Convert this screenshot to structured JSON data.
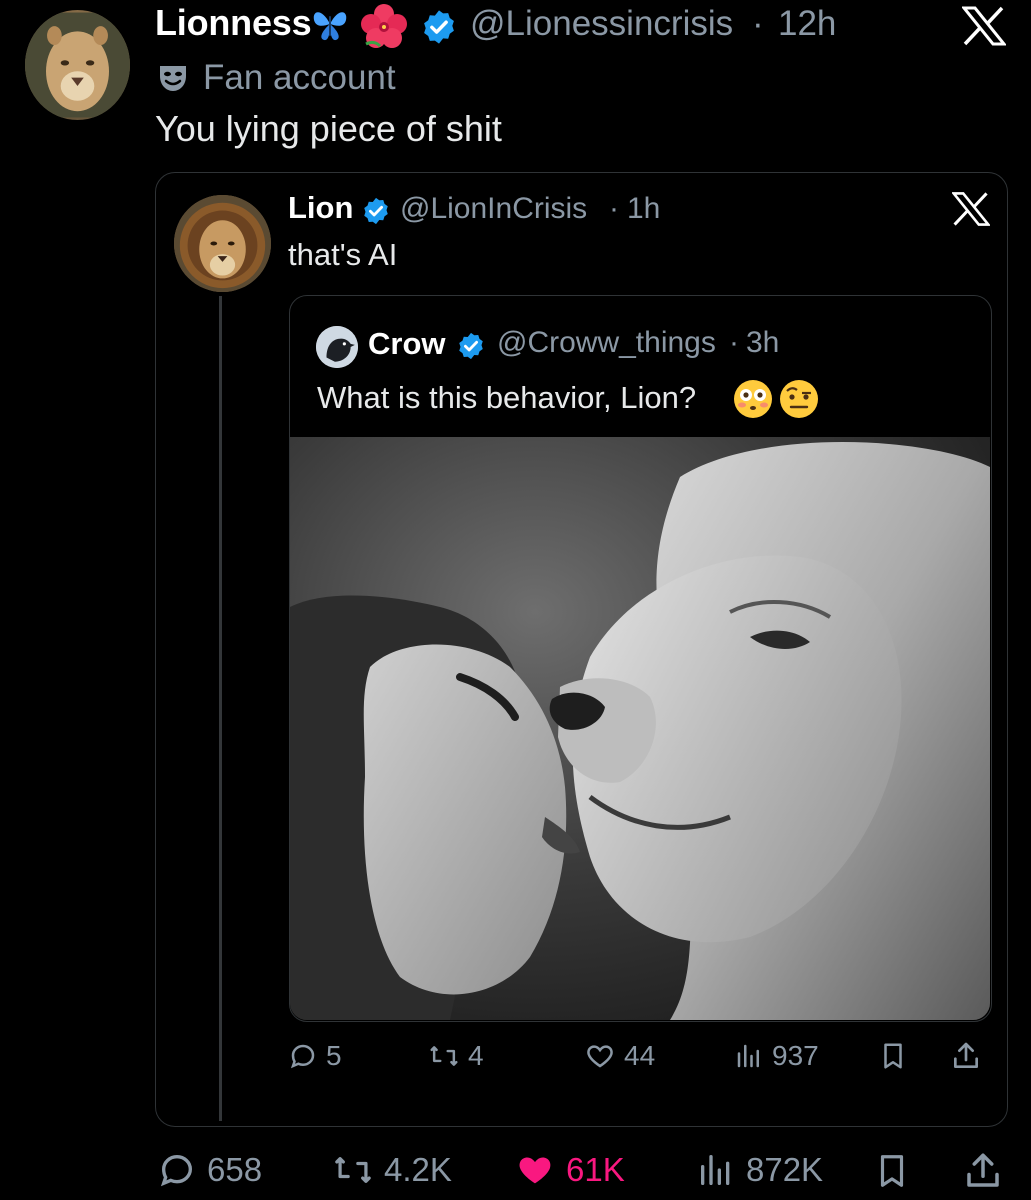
{
  "main_tweet": {
    "author_name": "Lionness",
    "handle": "@Lionessincrisis",
    "separator": "·",
    "time": "12h",
    "label_text": "Fan account",
    "text": "You lying piece of shit",
    "icons": [
      "butterfly-emoji",
      "hibiscus-emoji",
      "verified-badge-icon",
      "x-logo-icon",
      "fan-account-mask-icon"
    ],
    "actions": {
      "replies": "658",
      "reposts": "4.2K",
      "likes": "61K",
      "views": "872K"
    }
  },
  "quoted_tweet": {
    "author_name": "Lion",
    "handle": "@LionInCrisis",
    "separator": "·",
    "time": "1h",
    "text": "that's AI",
    "actions": {
      "replies": "5",
      "reposts": "4",
      "likes": "44",
      "views": "937"
    }
  },
  "nested_quote": {
    "author_name": "Crow",
    "handle": "@Croww_things",
    "separator": "·",
    "time": "3h",
    "text": "What is this behavior, Lion?",
    "emojis": [
      "flushed-face-emoji",
      "raised-eyebrow-face-emoji"
    ]
  },
  "colors": {
    "background": "#000000",
    "primary_text": "#e7e9ea",
    "secondary_text": "#8b98a5",
    "verified_blue": "#1d9bf0",
    "like_pink": "#f91880",
    "border": "#2f3336"
  }
}
